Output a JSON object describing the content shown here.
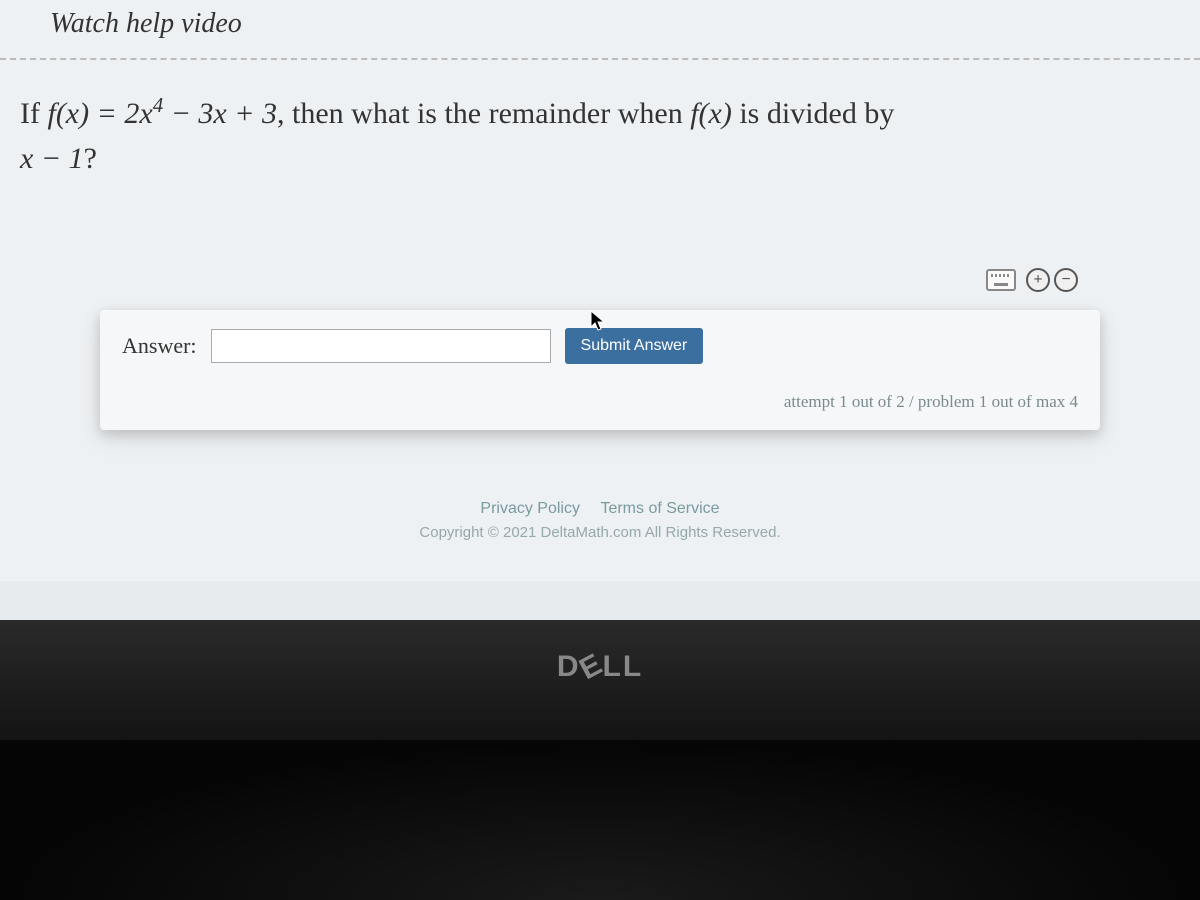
{
  "help_video_link": "Watch help video",
  "question": {
    "prefix": "If ",
    "fx_eq": "f(x) = 2x⁴ − 3x + 3",
    "middle": ", then what is the remainder when ",
    "fx": "f(x)",
    "suffix": " is divided by ",
    "divisor": "x − 1",
    "qmark": "?"
  },
  "answer": {
    "label": "Answer:",
    "value": "",
    "submit_label": "Submit Answer"
  },
  "zoom": {
    "in": "+",
    "out": "−"
  },
  "attempt_text": "attempt 1 out of 2 / problem 1 out of max 4",
  "footer": {
    "privacy": "Privacy Policy",
    "terms": "Terms of Service",
    "copyright": "Copyright © 2021 DeltaMath.com All Rights Reserved."
  },
  "logo": "DELL"
}
